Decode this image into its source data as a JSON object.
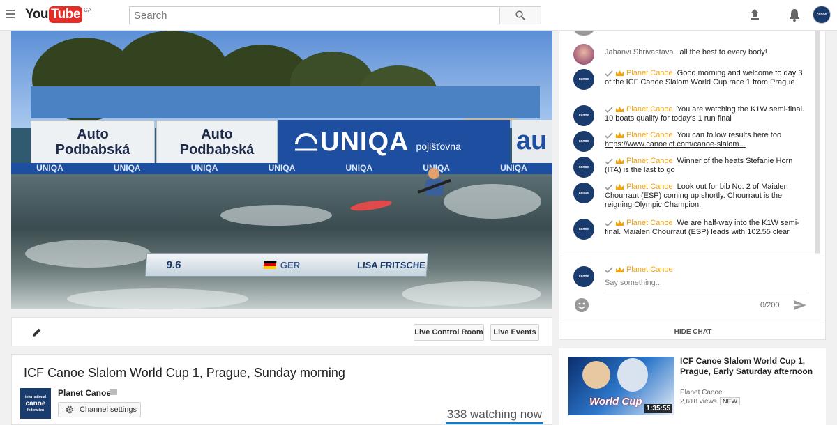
{
  "masthead": {
    "logo_you": "You",
    "logo_tube": "Tube",
    "logo_country": "CA",
    "search_placeholder": "Search",
    "account_avatar_text": "canoe"
  },
  "player": {
    "boards": [
      "Auto Podbabská",
      "Auto Podbabská"
    ],
    "sponsor_word": "UNIQA",
    "sponsor_sub": "pojišťovna",
    "sponsor_partial": "au",
    "strip_text": [
      "UNIQA",
      "UNIQA",
      "UNIQA",
      "UNIQA",
      "UNIQA",
      "UNIQA",
      "UNIQA"
    ],
    "overlay": {
      "time": "9.6",
      "country": "GER",
      "athlete": "LISA FRITSCHE"
    }
  },
  "actions": {
    "live_control_room": "Live Control Room",
    "live_events": "Live Events"
  },
  "video": {
    "title": "ICF Canoe Slalom World Cup 1, Prague, Sunday morning",
    "channel": "Planet Canoe",
    "channel_settings": "Channel settings",
    "watching": "338 watching now",
    "channel_avatar_lines": [
      "international",
      "canoe",
      "federation"
    ]
  },
  "chat": {
    "messages": [
      {
        "author": "Jahanvi Shrivastava",
        "owner": false,
        "text": "all the best to every body!"
      },
      {
        "author": "Planet Canoe",
        "owner": true,
        "text": "Good morning and welcome to day 3 of the ICF Canoe Slalom World Cup race 1 from Prague"
      },
      {
        "author": "Planet Canoe",
        "owner": true,
        "text": "You are watching the K1W semi-final. 10 boats qualify for today's 1 run final"
      },
      {
        "author": "Planet Canoe",
        "owner": true,
        "text": "You can follow results here too",
        "link": "https://www.canoeicf.com/canoe-slalom..."
      },
      {
        "author": "Planet Canoe",
        "owner": true,
        "text": "Winner of the heats Stefanie Horn (ITA) is the last to go"
      },
      {
        "author": "Planet Canoe",
        "owner": true,
        "text": "Look out for bib No. 2 of Maialen Chourraut (ESP) coming up shortly. Chourraut is the reigning Olympic Champion."
      },
      {
        "author": "Planet Canoe",
        "owner": true,
        "text": "We are half-way into the K1W semi-final. Maialen Chourraut (ESP) leads with 102.55 clear"
      }
    ],
    "input_author": "Planet Canoe",
    "input_placeholder": "Say something...",
    "char_count": "0/200",
    "hide_chat": "HIDE CHAT"
  },
  "related": {
    "title": "ICF Canoe Slalom World Cup 1, Prague, Early Saturday afternoon",
    "channel": "Planet Canoe",
    "views": "2,618 views",
    "badge": "NEW",
    "duration": "1:35:55",
    "thumb_text": "World Cup"
  },
  "colors": {
    "brand_red": "#e52d27",
    "owner_gold": "#f2a30e",
    "accent_blue": "#167ac6"
  }
}
